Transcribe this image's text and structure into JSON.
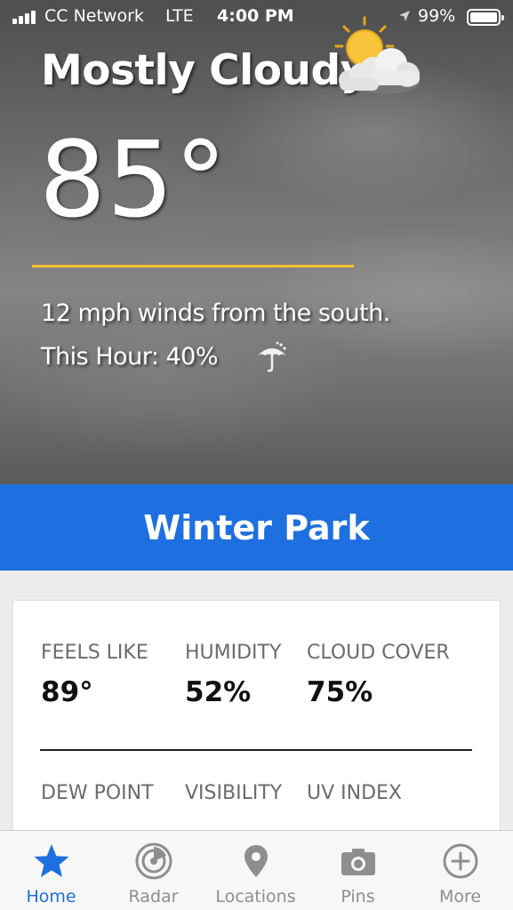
{
  "status_bar": {
    "carrier": "CC Network",
    "network_type": "LTE",
    "time": "4:00 PM",
    "battery_percent": "99%",
    "icons": [
      "signal-bars-icon",
      "location-arrow-icon",
      "battery-icon"
    ]
  },
  "current": {
    "condition": "Mostly Cloudy",
    "condition_icon": "partly-cloudy-icon",
    "temperature": "85°",
    "wind": "12 mph winds from the south.",
    "precip": "This Hour: 40%",
    "precip_icon": "umbrella-icon"
  },
  "location": {
    "name": "Winter Park"
  },
  "details": {
    "row1": [
      {
        "label": "FEELS LIKE",
        "value": "89°"
      },
      {
        "label": "HUMIDITY",
        "value": "52%"
      },
      {
        "label": "CLOUD COVER",
        "value": "75%"
      }
    ],
    "row2": [
      {
        "label": "DEW POINT"
      },
      {
        "label": "VISIBILITY"
      },
      {
        "label": "UV INDEX"
      }
    ]
  },
  "tab_bar": {
    "tabs": [
      {
        "label": "Home",
        "icon": "star-icon",
        "active": true
      },
      {
        "label": "Radar",
        "icon": "radar-icon",
        "active": false
      },
      {
        "label": "Locations",
        "icon": "map-pin-icon",
        "active": false
      },
      {
        "label": "Pins",
        "icon": "camera-icon",
        "active": false
      },
      {
        "label": "More",
        "icon": "plus-circle-icon",
        "active": false
      }
    ]
  },
  "colors": {
    "accent_blue": "#1e6fe0",
    "divider_yellow": "#f2c12e",
    "inactive_gray": "#8e8e8e"
  }
}
